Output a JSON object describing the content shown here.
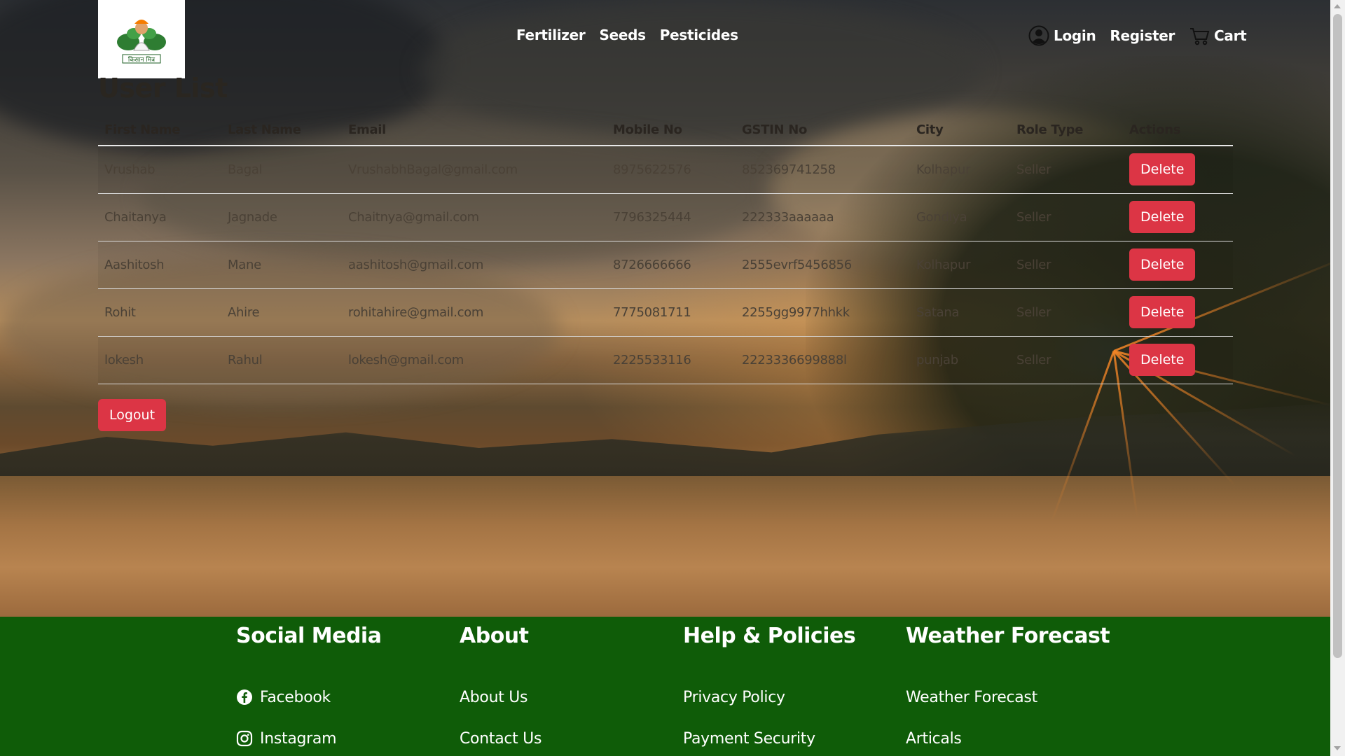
{
  "header": {
    "logo_alt": "किसान मित्र",
    "nav": [
      "Fertilizer",
      "Seeds",
      "Pesticides"
    ],
    "login_label": "Login",
    "register_label": "Register",
    "cart_label": "Cart"
  },
  "main": {
    "title": "User List",
    "columns": [
      "First Name",
      "Last Name",
      "Email",
      "Mobile No",
      "GSTIN No",
      "City",
      "Role Type",
      "Actions"
    ],
    "rows": [
      {
        "first": "Vrushab",
        "last": "Bagal",
        "email": "VrushabhBagal@gmail.com",
        "mobile": "8975622576",
        "gstin": "852369741258",
        "city": "Kolhapur",
        "role": "Seller",
        "action": "Delete"
      },
      {
        "first": "Chaitanya",
        "last": "Jagnade",
        "email": "Chaitnya@gmail.com",
        "mobile": "7796325444",
        "gstin": "222333aaaaaa",
        "city": "Gondiya",
        "role": "Seller",
        "action": "Delete"
      },
      {
        "first": "Aashitosh",
        "last": "Mane",
        "email": "aashitosh@gmail.com",
        "mobile": "8726666666",
        "gstin": "2555evrf5456856",
        "city": "Kolhapur",
        "role": "Seller",
        "action": "Delete"
      },
      {
        "first": "Rohit",
        "last": "Ahire",
        "email": "rohitahire@gmail.com",
        "mobile": "7775081711",
        "gstin": "2255gg9977hhkk",
        "city": "Satana",
        "role": "Seller",
        "action": "Delete"
      },
      {
        "first": "lokesh",
        "last": "Rahul",
        "email": "lokesh@gmail.com",
        "mobile": "2225533116",
        "gstin": "2223336699888l",
        "city": "punjab",
        "role": "Seller",
        "action": "Delete"
      }
    ],
    "logout_label": "Logout"
  },
  "footer": {
    "social": {
      "title": "Social Media",
      "links": [
        {
          "label": "Facebook",
          "icon": "facebook-icon"
        },
        {
          "label": "Instagram",
          "icon": "instagram-icon"
        }
      ]
    },
    "about": {
      "title": "About",
      "links": [
        "About Us",
        "Contact Us"
      ]
    },
    "help": {
      "title": "Help & Policies",
      "links": [
        "Privacy Policy",
        "Payment Security"
      ]
    },
    "weather": {
      "title": "Weather Forecast",
      "links": [
        "Weather Forecast",
        "Articals"
      ]
    }
  },
  "colors": {
    "danger": "#dc3545",
    "footer_bg": "#0f5c08"
  }
}
